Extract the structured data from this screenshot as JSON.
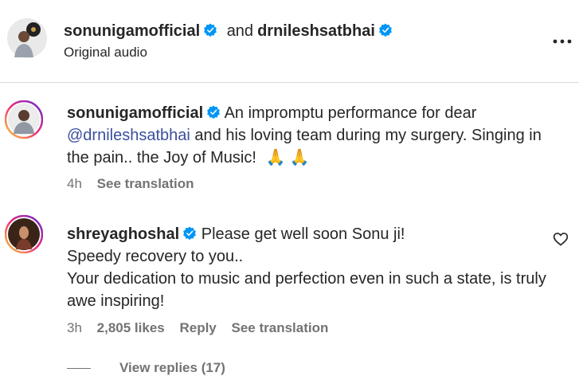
{
  "header": {
    "user1": "sonunigamofficial",
    "connector": "and",
    "user2": "drnileshsatbhai",
    "audio": "Original audio"
  },
  "comments": [
    {
      "username": "sonunigamofficial",
      "text_before": "An impromptu performance for dear",
      "mention": "@drnileshsatbhai",
      "text_after": "and his loving team during my surgery. Singing in the pain.. the Joy of Music!",
      "emoji": "🙏 🙏",
      "time": "4h",
      "see_translation": "See translation"
    },
    {
      "username": "shreyaghoshal",
      "line1": "Please get well soon Sonu ji!",
      "line2": "Speedy recovery to you..",
      "line3": "Your dedication to music and perfection even in such a state, is truly awe inspiring!",
      "time": "3h",
      "likes": "2,805 likes",
      "reply": "Reply",
      "see_translation": "See translation"
    }
  ],
  "view_replies": "View replies (17)",
  "colors": {
    "verified": "#0095f6",
    "mention": "#3b4f9e",
    "meta": "#737373"
  },
  "icons": [
    "verified-badge-icon",
    "more-options-icon",
    "heart-icon"
  ]
}
